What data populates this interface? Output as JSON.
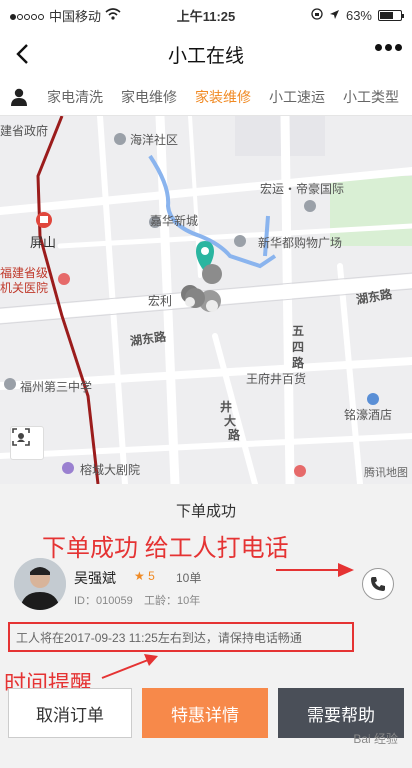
{
  "status_bar": {
    "carrier": "中国移动",
    "time": "上午11:25",
    "battery": "63%",
    "battery_level": 0.63
  },
  "nav": {
    "title": "小工在线"
  },
  "tabs": [
    "家电清洗",
    "家电维修",
    "家装维修",
    "小工速运",
    "小工类型"
  ],
  "active_tab": 2,
  "map": {
    "labels": {
      "gov": "建省政府",
      "haiyang": "海洋社区",
      "hongyun": "宏运・帝豪国际",
      "jiahua": "嘉华新城",
      "xinhua": "新华都购物广场",
      "pingshan": "屏山",
      "hospital1": "福建省级",
      "hospital2": "机关医院",
      "hongli": "宏利",
      "hudong1": "湖东路",
      "hudong2": "湖东路",
      "wusi1": "五",
      "wusi2": "四",
      "wusi3": "路",
      "wangfujing": "王府井百货",
      "school": "福州第三中学",
      "jingda1": "井",
      "jingda2": "大",
      "jingda3": "路",
      "minghao": "铭濠酒店",
      "rongcheng": "榕城大剧院"
    },
    "brand": "腾讯地图"
  },
  "order": {
    "title": "下单成功",
    "worker": {
      "name": "吴强斌",
      "rating": "5",
      "orders": "10单",
      "id": "ID：010059",
      "years": "工龄：10年"
    },
    "notice": "工人将在2017-09-23 11:25左右到达，请保持电话畅通"
  },
  "annotations": {
    "call": "下单成功 给工人打电话",
    "reminder": "时间提醒"
  },
  "buttons": {
    "cancel": "取消订单",
    "offer": "特惠详情",
    "help": "需要帮助"
  },
  "watermark": "Bai 经验",
  "colors": {
    "accent": "#f08a24",
    "annotation": "#e53333",
    "help_button": "#4a4f58",
    "offer_button": "#f7894a",
    "marker": "#2ab5a0"
  }
}
